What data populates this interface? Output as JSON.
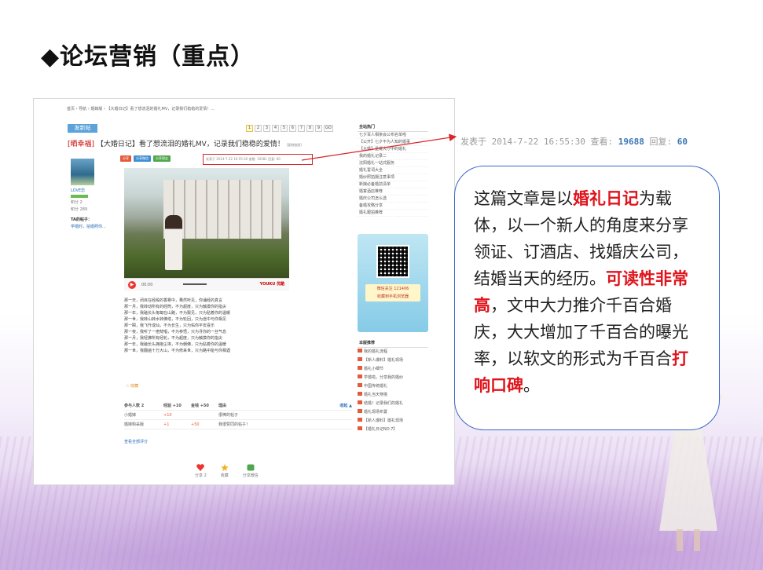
{
  "slide": {
    "title": "◆论坛营销（重点）"
  },
  "forum": {
    "breadcrumb": "首页 › 导航 › 婚嫁版 › 【大婚日记】看了想流泪的婚礼MV，记录我们稳稳的爱情！...",
    "new_post_label": "发新帖",
    "pager": [
      "1",
      "2",
      "3",
      "4",
      "5",
      "6",
      "7",
      "8",
      "9",
      "GO"
    ],
    "post_tag": "[晒幸福]",
    "post_title": "【大婚日记】看了想流泪的婚礼MV，记录我们稳稳的爱情！",
    "post_title_small": "[复制链接]",
    "user": {
      "name": "LOVE恋",
      "lines": [
        "积分 2",
        "积分 289"
      ],
      "ta_posts": "TA的帖子：",
      "ta_post_item": "学婚时，拍婚照你..."
    },
    "action_buttons": [
      "分享",
      "分享微信",
      "分享朋友"
    ],
    "meta_small": "发表于 2014-7-22 16:55:30   查看: 19281   回复: 60",
    "video": {
      "time": "00:00",
      "brand": "YOUKU 优酷"
    },
    "poem_lines": [
      "那一天，闭目在经殿的香雾中，蓦然听见，你诵经的真言",
      "那一月，我转动所有的经筒，不为超度，只为触摸你的指尖",
      "那一年，我磕长头匍匐在山路，不为觐见，只为贴着你的温暖",
      "那一世，我转山转水转佛塔，不为轮回，只为途中与你相见",
      "那一瞬，我飞升成仙，不为长生，只为佑你平安喜乐",
      "那一夜，我听了一宿梵唱，不为参悟，只为寻你的一丝气息",
      "那一月，我轻拂所有经轮，不为超度，只为触摸你的指尖",
      "那一年，我磕长头拥抱尘埃，不为朝佛，只为贴着你的温暖",
      "那一世，我翻遍十万大山，不为修来世，只为路中能与你相遇"
    ],
    "favorite_label": "收藏",
    "rate_header": [
      "参与人数 2",
      "经验 +10",
      "金钱 +50",
      "理由"
    ],
    "rate_rows": [
      [
        "小婚嫁",
        "+10",
        "",
        "很棒的帖子"
      ],
      [
        "婚嫁购采版",
        "+1",
        "+50",
        "我很赞同的帖子！"
      ]
    ],
    "rate_more": "查看全部评分",
    "rate_collapse": "收起 ▲",
    "bottom_actions": [
      "分享 2",
      "收藏",
      "分享微信"
    ],
    "hot_header": "全站热门",
    "hot_items": [
      "七夕百人相亲会公布名单啦",
      "【公开】七夕不为人知的婚事",
      "【大婚】星耀大厅中的婚礼",
      "我的婚礼记录二",
      "沈阳婚礼一站式服务",
      "婚礼誓词大全",
      "婚纱照拍摄注意事项",
      "新娘必备婚前清单",
      "婚宴酒店推荐",
      "婚庆公司怎么选",
      "备婚攻略分享",
      "婚礼跟拍推荐"
    ],
    "qr_label_line1": "微信关注 121406",
    "qr_label_line2": "收藏到手机浏览器",
    "rec_header": "本版推荐",
    "rec_items": [
      "我的婚礼流程",
      "【新人爆料】婚礼现场",
      "婚礼小细节",
      "学婚啦，分享我的婚纱",
      "中国传统婚礼",
      "婚礼当天穿搭",
      "结婚！记录我们的婚礼",
      "婚礼现场布置",
      "【新人爆料】婚礼现场",
      "【婚礼日记NO.7】"
    ]
  },
  "zoom_meta": {
    "prefix": "发表于 2014-7-22 16:55:30  查看: ",
    "views": "19688",
    "mid": "  回复: ",
    "replies": "60"
  },
  "callout": {
    "p1": "这篇文章是以",
    "h1": "婚礼日记",
    "p2": "为载体，以一个新人的角度来分享领证、订酒店、找婚庆公司，结婚当天的经历。",
    "h2": "可读性非常高",
    "p3": "，文中大力推介千百合婚庆，大大增加了千百合的曝光率，以软文的形式为千百合",
    "h3": "打响口碑",
    "p4": "。"
  },
  "colors": {
    "highlight_red": "#e0141c",
    "callout_border": "#3b67c9",
    "meta_box_red": "#d9252a"
  }
}
